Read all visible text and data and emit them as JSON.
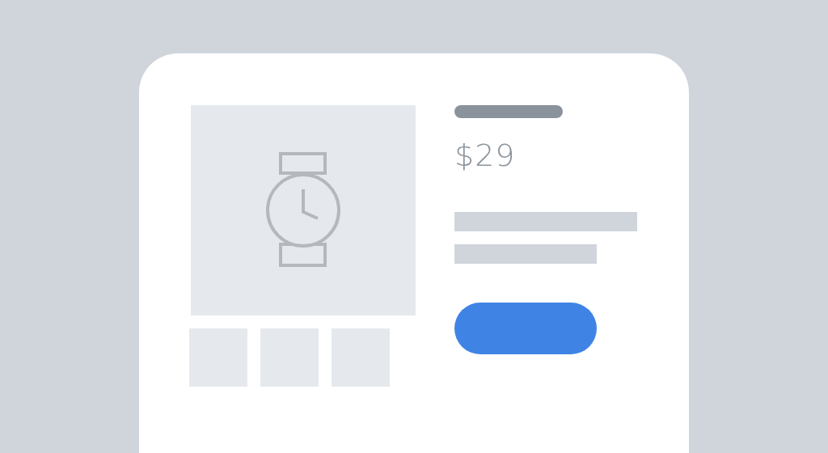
{
  "product": {
    "price": "$29",
    "thumbnails": [
      {
        "kind": "placeholder"
      },
      {
        "kind": "placeholder"
      },
      {
        "kind": "placeholder"
      }
    ]
  }
}
